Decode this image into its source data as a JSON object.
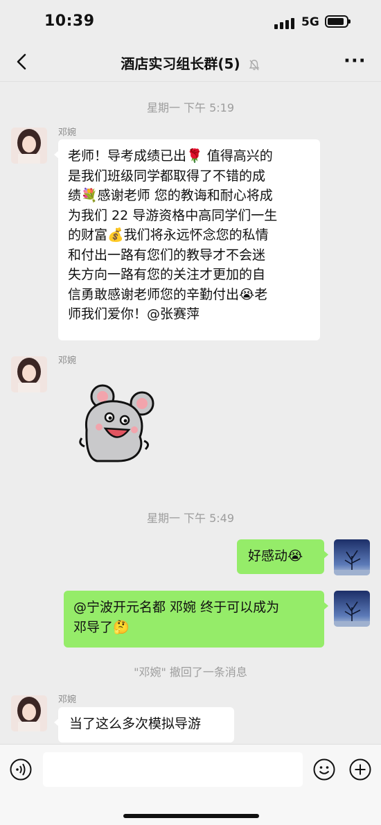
{
  "status_bar": {
    "time": "10:39",
    "network": "5G"
  },
  "header": {
    "title": "酒店实习组长群(5)"
  },
  "messages": {
    "stamp1": "星期一 下午 5:19",
    "sender": "邓婉",
    "msg1_lines": [
      "老师！导考成绩已出🌹 值得高兴的",
      "是我们班级同学都取得了不错的成",
      "绩💐感谢老师 您的教诲和耐心将成",
      "为我们 22 导游资格中高同学们一生",
      "的财富💰我们将永远怀念您的私情",
      "和付出一路有您们的教导才不会迷",
      "失方向一路有您的关注才更加的自",
      "信勇敢感谢老师您的辛勤付出😭老",
      "师我们爱你！@张赛萍"
    ],
    "stamp2": "星期一 下午 5:49",
    "msg_right1": "好感动😭",
    "msg_right2_lines": [
      "@宁波开元名都 邓婉 终于可以成为",
      "邓导了🤔"
    ],
    "recall_notice": "\"邓婉\" 撤回了一条消息",
    "msg_last": "当了这么多次模拟导游"
  },
  "icons": [
    "back-icon",
    "mute-bell-icon",
    "more-icon",
    "voice-icon",
    "emoji-icon",
    "plus-icon"
  ]
}
